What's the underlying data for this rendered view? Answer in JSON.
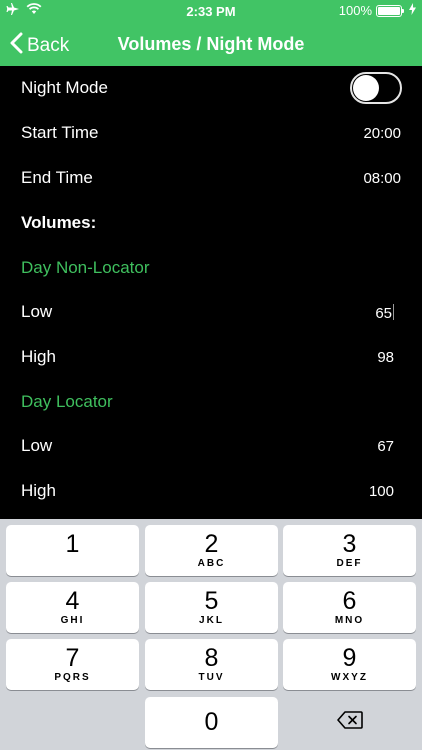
{
  "status_bar": {
    "time": "2:33 PM",
    "battery_percent": "100%",
    "icons": [
      "airplane-icon",
      "wifi-icon",
      "battery-icon",
      "charging-icon"
    ]
  },
  "nav": {
    "back_label": "Back",
    "title": "Volumes / Night Mode"
  },
  "settings": {
    "night_mode_label": "Night Mode",
    "night_mode_on": false,
    "start_time_label": "Start Time",
    "start_time_value": "20:00",
    "end_time_label": "End Time",
    "end_time_value": "08:00",
    "volumes_header": "Volumes:"
  },
  "day_non_locator": {
    "header": "Day Non-Locator",
    "low_label": "Low",
    "low_value": "65",
    "high_label": "High",
    "high_value": "98"
  },
  "day_locator": {
    "header": "Day Locator",
    "low_label": "Low",
    "low_value": "67",
    "high_label": "High",
    "high_value": "100"
  },
  "keyboard": {
    "keys": [
      {
        "num": "1",
        "letters": ""
      },
      {
        "num": "2",
        "letters": "ABC"
      },
      {
        "num": "3",
        "letters": "DEF"
      },
      {
        "num": "4",
        "letters": "GHI"
      },
      {
        "num": "5",
        "letters": "JKL"
      },
      {
        "num": "6",
        "letters": "MNO"
      },
      {
        "num": "7",
        "letters": "PQRS"
      },
      {
        "num": "8",
        "letters": "TUV"
      },
      {
        "num": "9",
        "letters": "WXYZ"
      },
      {
        "num": "0",
        "letters": ""
      }
    ]
  },
  "colors": {
    "accent_green": "#41c465",
    "section_green": "#3fbf5e",
    "background": "#000000",
    "keyboard_bg": "#d1d4d9"
  }
}
